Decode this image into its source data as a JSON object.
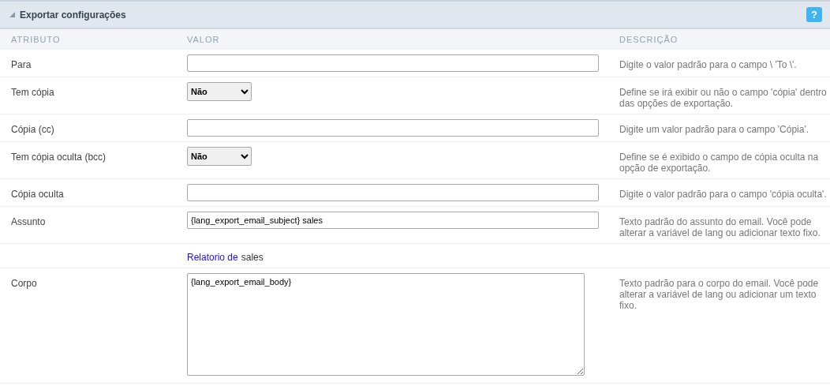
{
  "panel": {
    "title": "Exportar configurações",
    "help": "?"
  },
  "columns": [
    "ATRIBUTO",
    "VALOR",
    "DESCRIÇÃO"
  ],
  "rows": [
    {
      "kind": "text",
      "label": "Para",
      "value": "",
      "description": "Digite o valor padrão para o campo \\ 'To \\'."
    },
    {
      "kind": "select",
      "label": "Tem cópia",
      "value": "Não",
      "description": "Define se irá exibir ou não o campo 'cópia' dentro das opções de exportação."
    },
    {
      "kind": "text",
      "label": "Cópia (cc)",
      "value": "",
      "description": "Digite um valor padrão para o campo 'Cópia'."
    },
    {
      "kind": "select",
      "label": "Tem cópia oculta (bcc)",
      "value": "Não",
      "description": "Define se é exibido o campo de cópia oculta na opção de exportação."
    },
    {
      "kind": "text",
      "label": "Cópia oculta",
      "value": "",
      "description": "Digite o valor padrão para o campo 'cópia oculta'."
    },
    {
      "kind": "text",
      "label": "Assunto",
      "value": "{lang_export_email_subject} sales",
      "description": "Texto padrão do assunto do email. Você pode alterar a variável de lang ou adicionar texto fixo."
    },
    {
      "kind": "note",
      "link": "Relatorio de",
      "text": "sales"
    },
    {
      "kind": "textarea",
      "label": "Corpo",
      "value": "{lang_export_email_body}",
      "description": "Texto padrão para o corpo do email. Você pode alterar a variável de lang ou adicionar um texto fixo."
    }
  ]
}
